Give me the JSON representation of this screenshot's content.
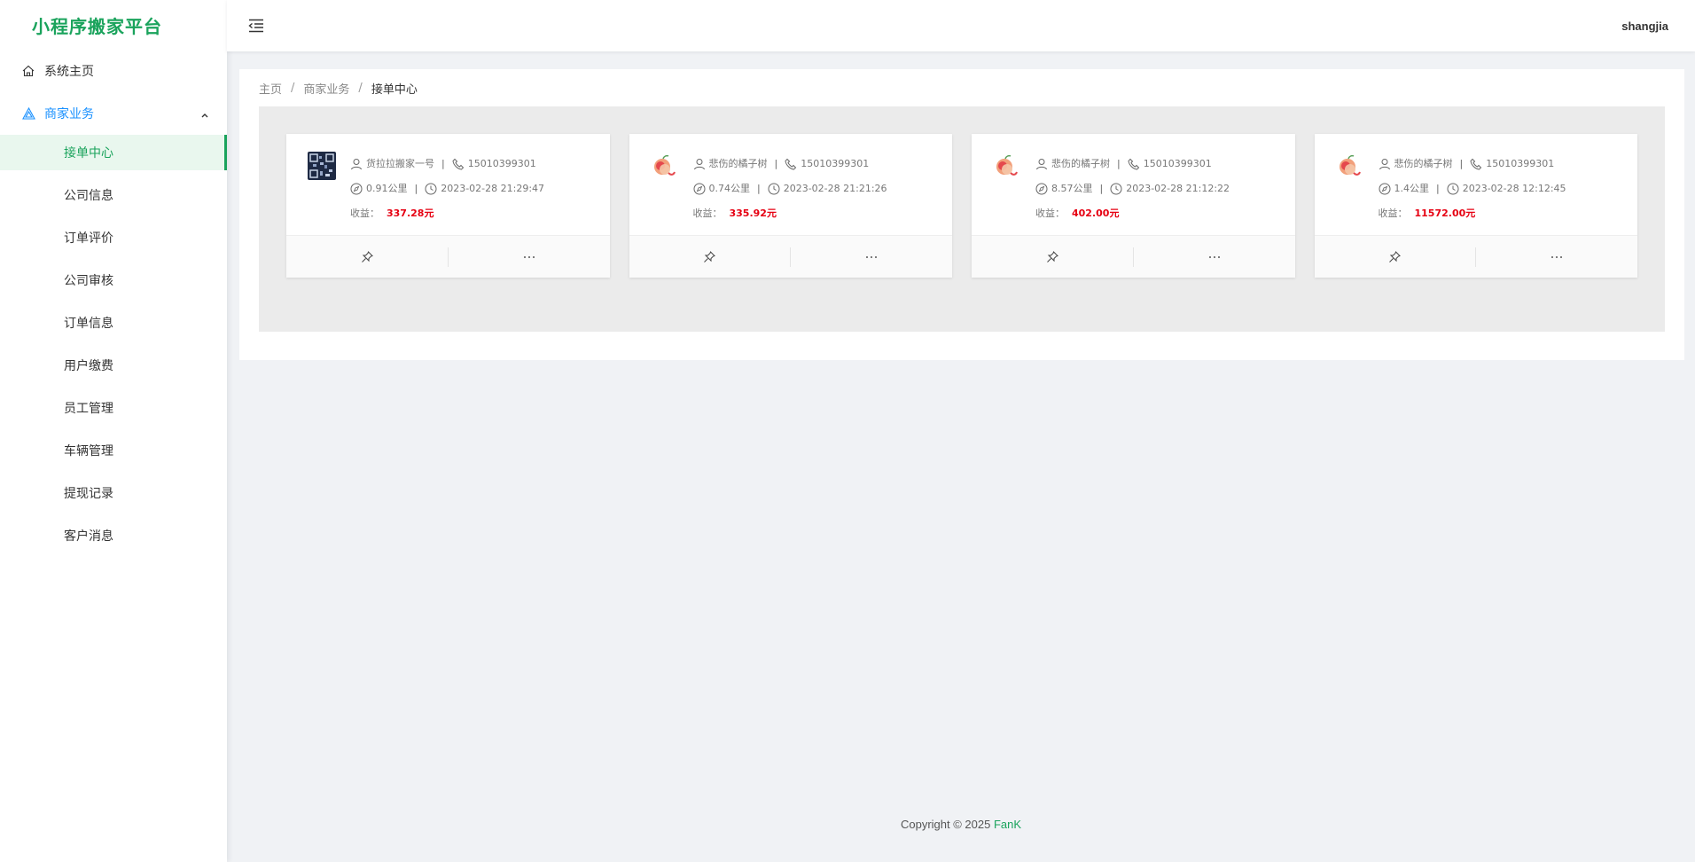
{
  "app": {
    "title": "小程序搬家平台",
    "brand_color": "#1aa35c",
    "accent_color": "#1890ff"
  },
  "sidebar": {
    "home": {
      "label": "系统主页",
      "icon": "home-icon"
    },
    "group": {
      "label": "商家业务",
      "icon": "triangle-icon",
      "expanded": true
    },
    "items": [
      {
        "label": "接单中心",
        "active": true
      },
      {
        "label": "公司信息"
      },
      {
        "label": "订单评价"
      },
      {
        "label": "公司审核"
      },
      {
        "label": "订单信息"
      },
      {
        "label": "用户缴费"
      },
      {
        "label": "员工管理"
      },
      {
        "label": "车辆管理"
      },
      {
        "label": "提现记录"
      },
      {
        "label": "客户消息"
      }
    ]
  },
  "header": {
    "username": "shangjia",
    "menu_icon": "menu-fold-icon"
  },
  "breadcrumb": {
    "items": [
      "主页",
      "商家业务",
      "接单中心"
    ],
    "separator": "/"
  },
  "orders": [
    {
      "avatar": "qr-avatar",
      "name": "货拉拉搬家一号",
      "phone": "15010399301",
      "distance": "0.91公里",
      "time": "2023-02-28 21:29:47",
      "earning_label": "收益：",
      "earning": "337.28元"
    },
    {
      "avatar": "peach-avatar",
      "name": "悲伤的橘子树",
      "phone": "15010399301",
      "distance": "0.74公里",
      "time": "2023-02-28 21:21:26",
      "earning_label": "收益：",
      "earning": "335.92元"
    },
    {
      "avatar": "peach-avatar",
      "name": "悲伤的橘子树",
      "phone": "15010399301",
      "distance": "8.57公里",
      "time": "2023-02-28 21:12:22",
      "earning_label": "收益：",
      "earning": "402.00元"
    },
    {
      "avatar": "peach-avatar",
      "name": "悲伤的橘子树",
      "phone": "15010399301",
      "distance": "1.4公里",
      "time": "2023-02-28 12:12:45",
      "earning_label": "收益：",
      "earning": "11572.00元"
    }
  ],
  "card_actions": {
    "pin": "pushpin-icon",
    "more": "ellipsis-icon"
  },
  "footer": {
    "prefix": "Copyright © 2025",
    "brand": "FanK"
  }
}
